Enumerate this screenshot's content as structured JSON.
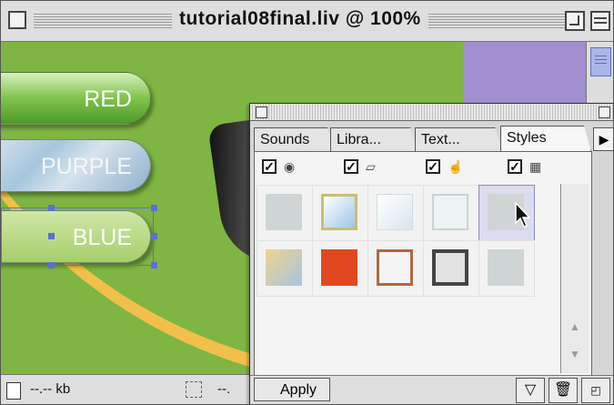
{
  "window": {
    "title": "tutorial08final.liv @ 100%"
  },
  "canvas": {
    "buttons": [
      {
        "label": "RED"
      },
      {
        "label": "PURPLE"
      },
      {
        "label": "BLUE"
      }
    ]
  },
  "statusbar": {
    "size": "--.-- kb",
    "size2": "--."
  },
  "palette": {
    "tabs": [
      {
        "label": "Sounds"
      },
      {
        "label": "Libra..."
      },
      {
        "label": "Text..."
      },
      {
        "label": "Styles"
      }
    ],
    "apply_label": "Apply",
    "more_tabs_icon": "triangle-right-icon"
  },
  "colors": {
    "canvas_green": "#7fb543",
    "purple_block": "#a08ecf",
    "orange_curve": "#f2c04a",
    "selection_blue": "#5a6fd8"
  }
}
